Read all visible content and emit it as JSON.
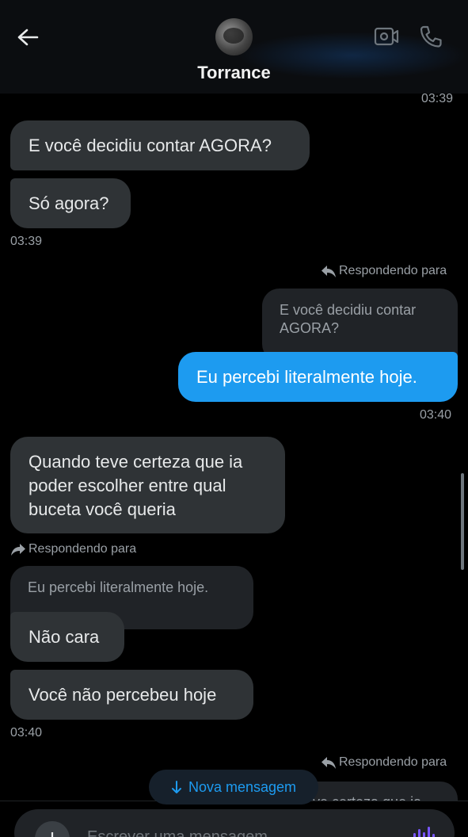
{
  "header": {
    "contact_name": "Torrance",
    "back_icon": "arrow-left-icon",
    "video_icon": "video-icon",
    "call_icon": "phone-icon"
  },
  "messages": {
    "ts_top": "03:39",
    "m1": "E você decidiu contar AGORA?",
    "m2": "Só agora?",
    "ts1": "03:39",
    "reply1_label": "Respondendo para",
    "reply1_quote": "E você decidiu contar AGORA?",
    "m3": "Eu percebi literalmente hoje.",
    "ts2": "03:40",
    "m4": "Quando teve certeza que ia poder escolher entre qual buceta você queria",
    "reply2_label": "Respondendo para",
    "reply2_quote": "Eu percebi literalmente hoje.",
    "m5": "Não cara",
    "m6": "Você não percebeu hoje",
    "ts3": "03:40",
    "reply3_label": "Respondendo para",
    "reply3_quote_partial": "...ve certeza que ia"
  },
  "new_message": {
    "label": "Nova mensagem",
    "icon": "arrow-down-icon"
  },
  "composer": {
    "placeholder": "Escrever uma mensagem",
    "plus_icon": "plus-icon",
    "mic_icon": "voice-wave-icon"
  },
  "colors": {
    "sent_bubble": "#1d9bf0",
    "received_bubble": "#2f3336",
    "accent": "#1d9bf0",
    "background": "#000000"
  }
}
